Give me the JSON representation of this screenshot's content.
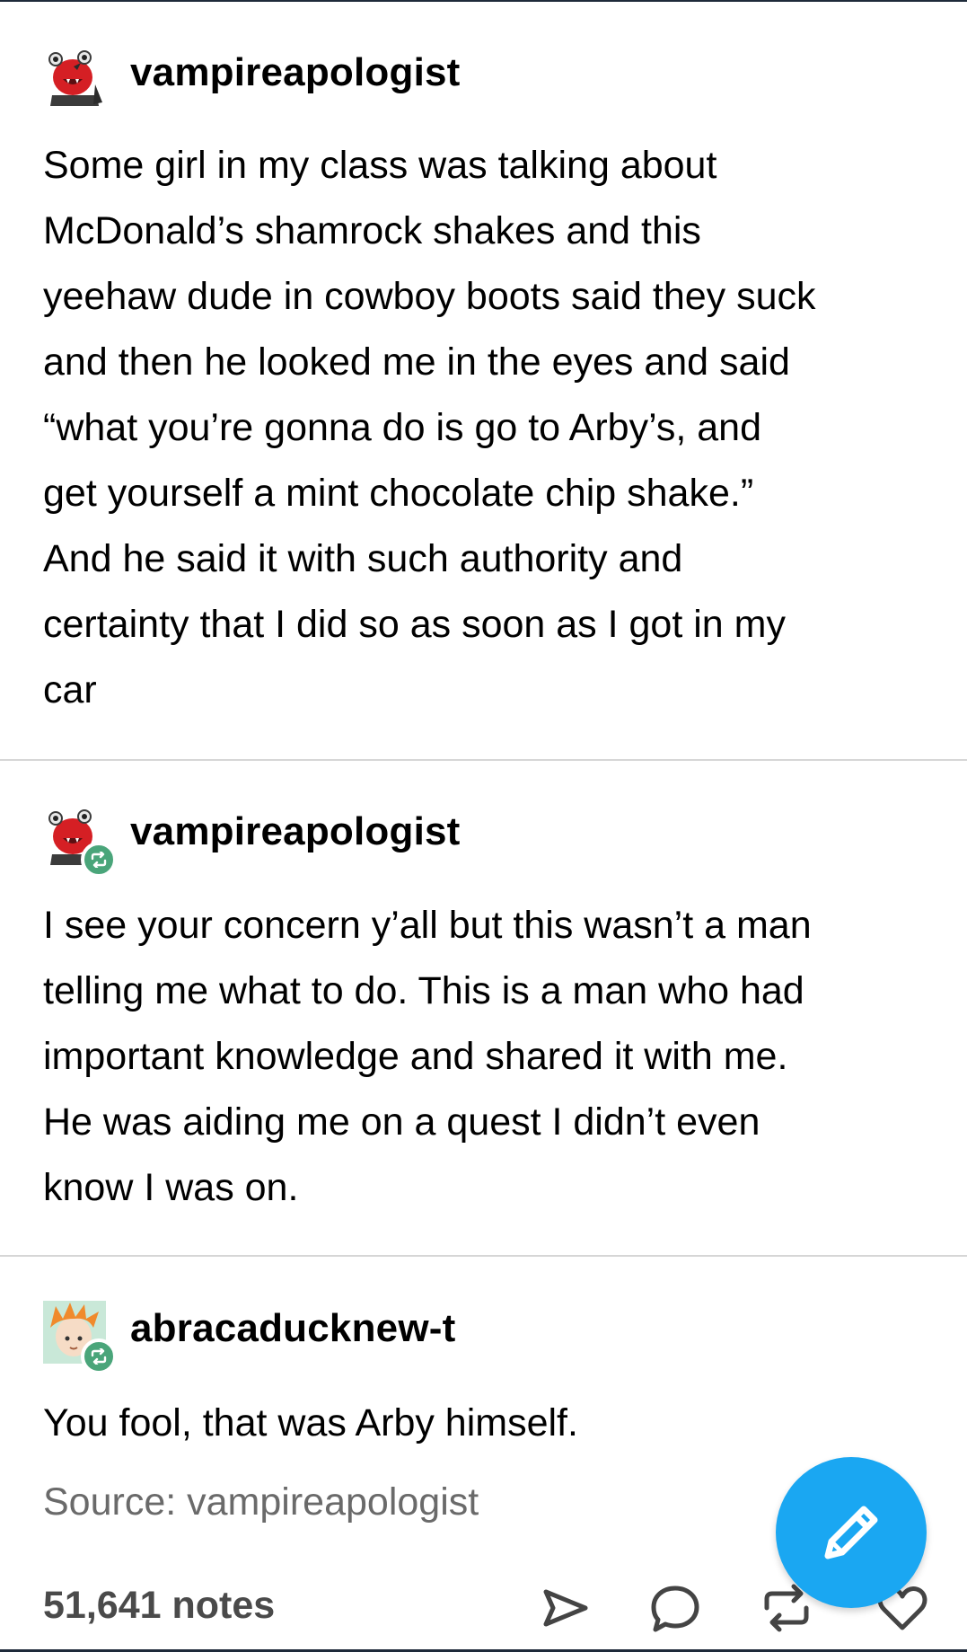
{
  "posts": [
    {
      "username": "vampireapologist",
      "avatar": "red-monster-avatar",
      "reblog": false,
      "text": "Some girl in my class was talking about\nMcDonald’s shamrock shakes and this\nyeehaw dude in cowboy boots said they suck\nand then he looked me in the eyes and said\n“what you’re gonna do is go to Arby’s, and\nget yourself a mint chocolate chip shake.”\nAnd he said it with such authority and\ncertainty that I did so as soon as I got in my\ncar"
    },
    {
      "username": "vampireapologist",
      "avatar": "red-monster-avatar",
      "reblog": true,
      "text": "I see your concern y’all but this wasn’t a man\ntelling me what to do. This is a man who had\nimportant knowledge and shared it with me.\nHe was aiding me on a quest I didn’t even\nknow I was on."
    },
    {
      "username": "abracaducknew-t",
      "avatar": "anime-character-avatar",
      "reblog": true,
      "text": "You fool, that was Arby himself."
    }
  ],
  "footer": {
    "source": "Source: vampireapologist",
    "notes": "51,641 notes",
    "actions": [
      "share-icon",
      "reply-icon",
      "reblog-icon",
      "like-icon"
    ]
  },
  "fab": {
    "icon": "pencil-icon",
    "color": "#1aa7f2"
  },
  "colors": {
    "reblog_badge": "#4aa57a",
    "divider": "#d6d6d6",
    "muted_text": "#6a6a6a"
  }
}
